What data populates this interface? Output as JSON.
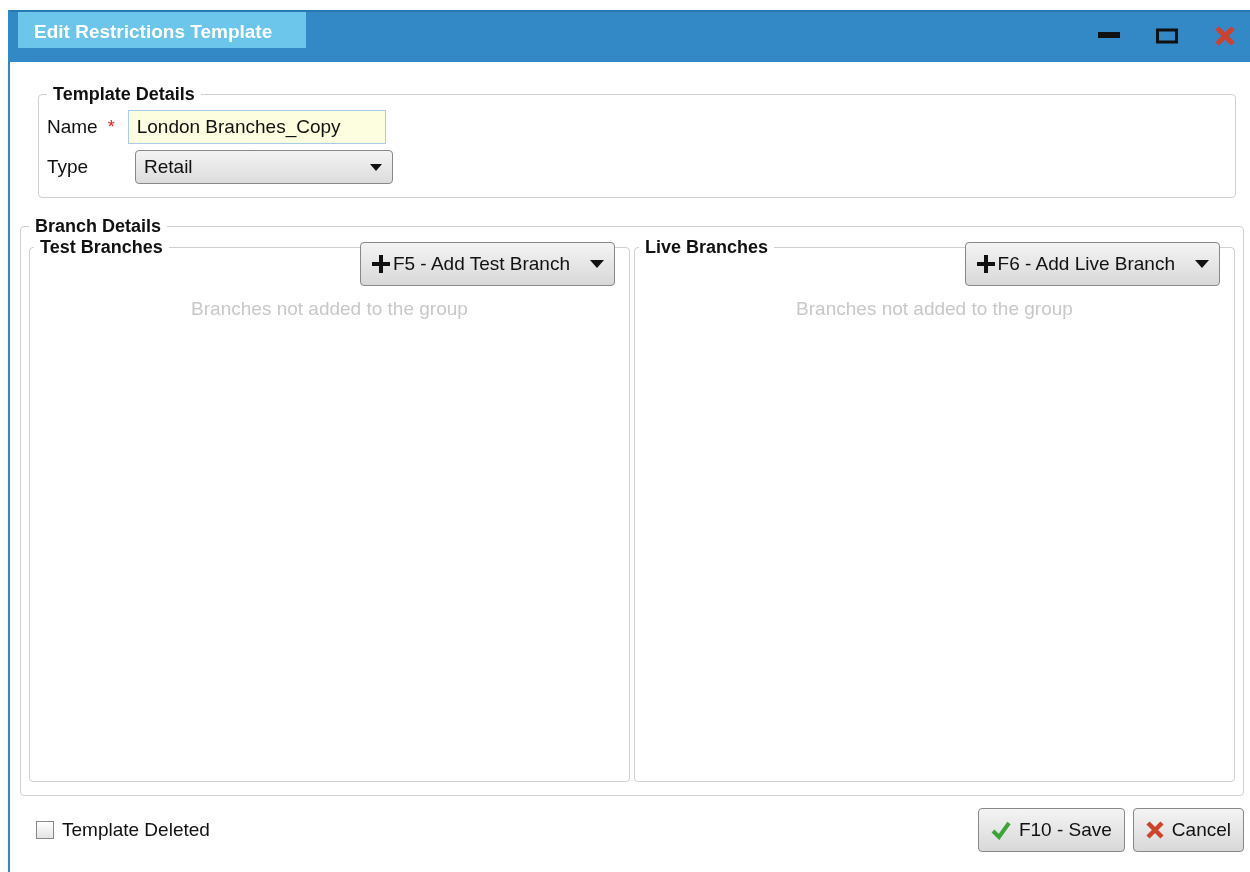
{
  "window": {
    "title": "Edit Restrictions Template"
  },
  "template_details": {
    "title": "Template Details",
    "name": {
      "label": "Name",
      "required_mark": "*",
      "value": "London Branches_Copy"
    },
    "type": {
      "label": "Type",
      "value": "Retail"
    }
  },
  "branch_details": {
    "title": "Branch Details",
    "panels": [
      {
        "title": "Test Branches",
        "button": "F5 - Add Test Branch",
        "empty_message": "Branches not added to the group"
      },
      {
        "title": "Live Branches",
        "button": "F6 - Add Live Branch",
        "empty_message": "Branches not added to the group"
      }
    ]
  },
  "template_deleted": {
    "label": "Template Deleted",
    "checked": false
  },
  "buttons": [
    {
      "kind": "save",
      "label": "F10 - Save"
    },
    {
      "kind": "cancel",
      "label": "Cancel"
    }
  ]
}
